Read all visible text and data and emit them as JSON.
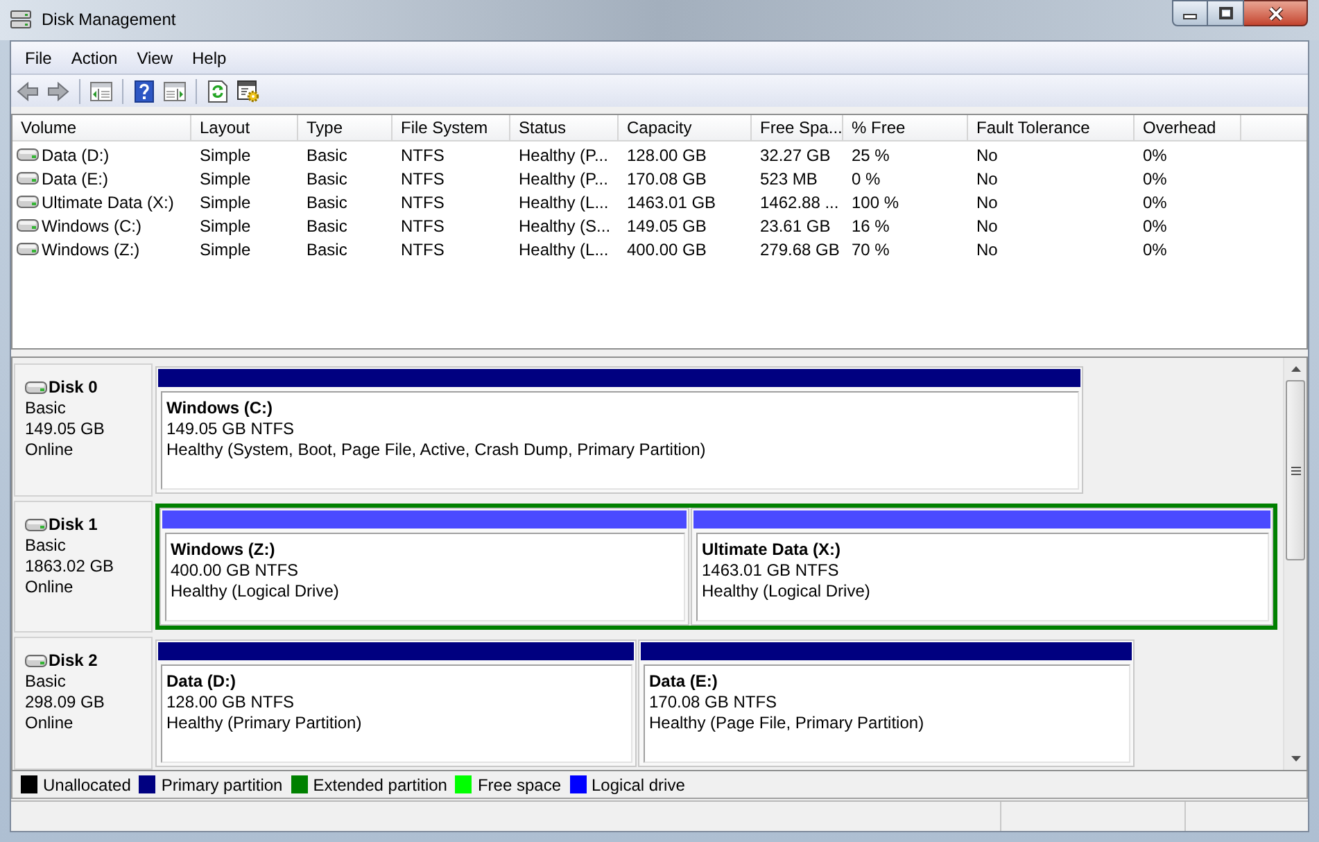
{
  "window": {
    "title": "Disk Management"
  },
  "menu": [
    {
      "label": "File"
    },
    {
      "label": "Action"
    },
    {
      "label": "View"
    },
    {
      "label": "Help"
    }
  ],
  "volume_list": {
    "columns": [
      "Volume",
      "Layout",
      "Type",
      "File System",
      "Status",
      "Capacity",
      "Free Spa...",
      "% Free",
      "Fault Tolerance",
      "Overhead"
    ],
    "rows": [
      [
        "Data (D:)",
        "Simple",
        "Basic",
        "NTFS",
        "Healthy (P...",
        "128.00 GB",
        "32.27 GB",
        "25 %",
        "No",
        "0%"
      ],
      [
        "Data (E:)",
        "Simple",
        "Basic",
        "NTFS",
        "Healthy (P...",
        "170.08 GB",
        "523 MB",
        "0 %",
        "No",
        "0%"
      ],
      [
        "Ultimate Data (X:)",
        "Simple",
        "Basic",
        "NTFS",
        "Healthy (L...",
        "1463.01 GB",
        "1462.88 ...",
        "100 %",
        "No",
        "0%"
      ],
      [
        "Windows (C:)",
        "Simple",
        "Basic",
        "NTFS",
        "Healthy (S...",
        "149.05 GB",
        "23.61 GB",
        "16 %",
        "No",
        "0%"
      ],
      [
        "Windows (Z:)",
        "Simple",
        "Basic",
        "NTFS",
        "Healthy (L...",
        "400.00 GB",
        "279.68 GB",
        "70 %",
        "No",
        "0%"
      ]
    ]
  },
  "disks": [
    {
      "name": "Disk 0",
      "type": "Basic",
      "size": "149.05 GB",
      "status": "Online",
      "partitions": [
        {
          "kind": "primary",
          "name": "Windows (C:)",
          "detail": "149.05 GB NTFS",
          "status": "Healthy (System, Boot, Page File, Active, Crash Dump, Primary Partition)"
        }
      ]
    },
    {
      "name": "Disk 1",
      "type": "Basic",
      "size": "1863.02 GB",
      "status": "Online",
      "partitions": [
        {
          "kind": "extended",
          "children": [
            {
              "kind": "logical",
              "name": "Windows (Z:)",
              "detail": "400.00 GB NTFS",
              "status": "Healthy (Logical Drive)"
            },
            {
              "kind": "logical",
              "name": "Ultimate Data (X:)",
              "detail": "1463.01 GB NTFS",
              "status": "Healthy (Logical Drive)"
            }
          ]
        }
      ]
    },
    {
      "name": "Disk 2",
      "type": "Basic",
      "size": "298.09 GB",
      "status": "Online",
      "partitions": [
        {
          "kind": "primary",
          "name": "Data (D:)",
          "detail": "128.00 GB NTFS",
          "status": "Healthy (Primary Partition)"
        },
        {
          "kind": "primary",
          "name": "Data (E:)",
          "detail": "170.08 GB NTFS",
          "status": "Healthy (Page File, Primary Partition)"
        }
      ]
    }
  ],
  "legend": [
    {
      "label": "Unallocated",
      "color": "#000000"
    },
    {
      "label": "Primary partition",
      "color": "#000080"
    },
    {
      "label": "Extended partition",
      "color": "#008000"
    },
    {
      "label": "Free space",
      "color": "#00ff00"
    },
    {
      "label": "Logical drive",
      "color": "#0000ff"
    }
  ]
}
